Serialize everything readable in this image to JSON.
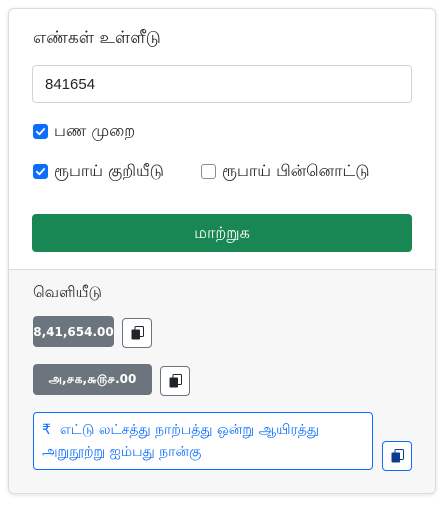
{
  "form": {
    "title": "எண்கள் உள்ளீடு",
    "number_value": "841654",
    "checkbox_currency_format": {
      "label": "பண முறை",
      "checked": true
    },
    "checkbox_rupee_symbol": {
      "label": "ரூபாய் குறியீடு",
      "checked": true
    },
    "checkbox_rupee_fraction": {
      "label": "ரூபாய் பின்னொட்டு",
      "checked": false
    },
    "convert_label": "மாற்றுக"
  },
  "output": {
    "label": "வெளியீடு",
    "numeric_value": "8,41,654.00",
    "tamil_numeral_value": "அ,௪௧,௬௫௪.00",
    "words_symbol": "₹",
    "words_text": "எட்டு லட்சத்து நாற்பத்து ஒன்று ஆயிரத்து அறுநூற்று ஐம்பது நான்கு"
  },
  "colors": {
    "primary": "#0d6efd",
    "success": "#198754",
    "secondary": "#6c757d",
    "footer_bg": "#f7f7f7"
  },
  "icons": {
    "copy": "clipboard-copy-icon",
    "check": "checkmark-icon"
  }
}
